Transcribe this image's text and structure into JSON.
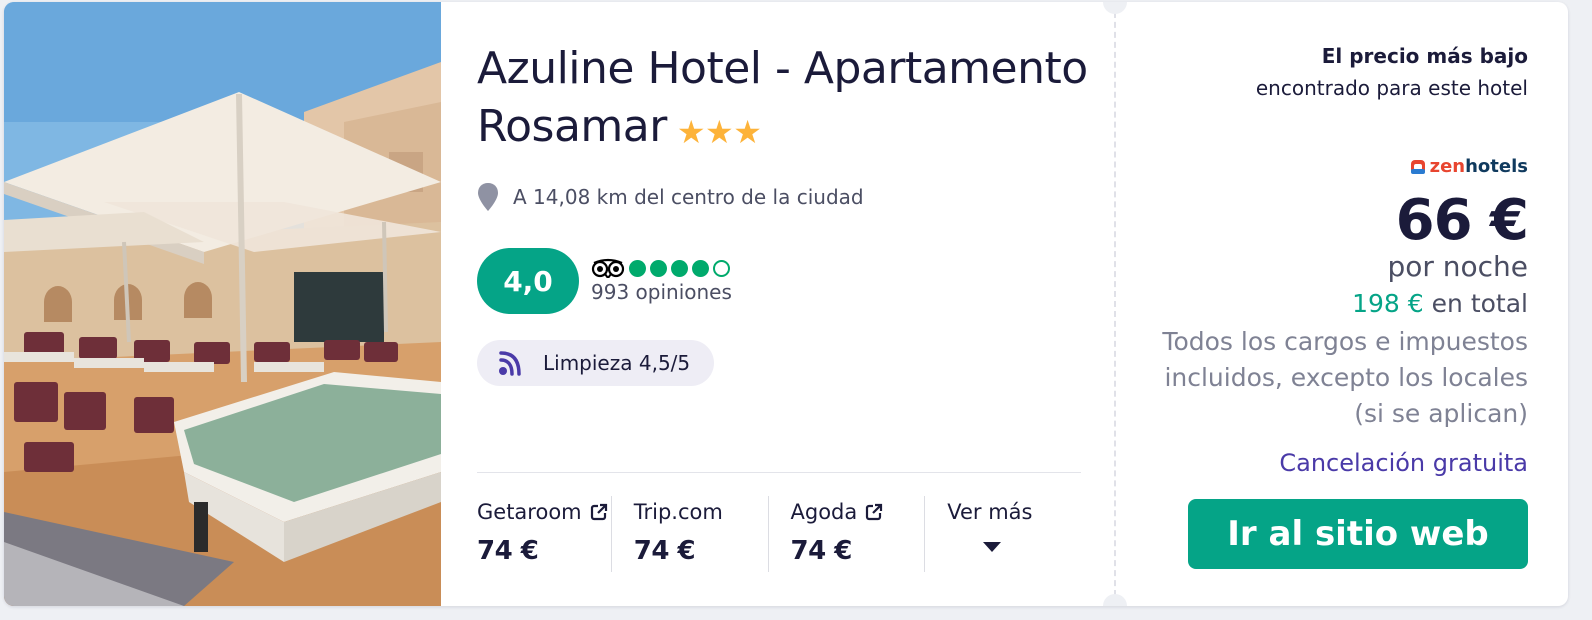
{
  "hotel": {
    "name": "Azuline Hotel - Apartamento Rosamar",
    "stars": 3,
    "location": "A 14,08 km del centro de la ciudad"
  },
  "rating": {
    "score": "4,0",
    "bubbles": 4,
    "bubbles_max": 5,
    "reviews": "993 opiniones"
  },
  "cleanliness": {
    "label": "Limpieza",
    "score": "4,5/5"
  },
  "providers": [
    {
      "name": "Getaroom",
      "price": "74 €",
      "external": true
    },
    {
      "name": "Trip.com",
      "price": "74 €",
      "external": false
    },
    {
      "name": "Agoda",
      "price": "74 €",
      "external": true
    }
  ],
  "more_label": "Ver más",
  "offer": {
    "lowest_bold": "El precio más bajo",
    "lowest_rest": "encontrado para este hotel",
    "provider_logo_a": "zen",
    "provider_logo_b": "hotels",
    "price": "66 €",
    "per_night": "por noche",
    "total_amount": "198 €",
    "total_label": "en total",
    "taxes": "Todos los cargos e impuestos incluidos, excepto los locales (si se aplican)",
    "cancellation": "Cancelación gratuita",
    "cta": "Ir al sitio web"
  },
  "colors": {
    "accent": "#05a487",
    "star": "#fdb33a",
    "tripadvisor": "#00aa6c",
    "cancel": "#4a3aa8",
    "text": "#1b1b3a"
  }
}
